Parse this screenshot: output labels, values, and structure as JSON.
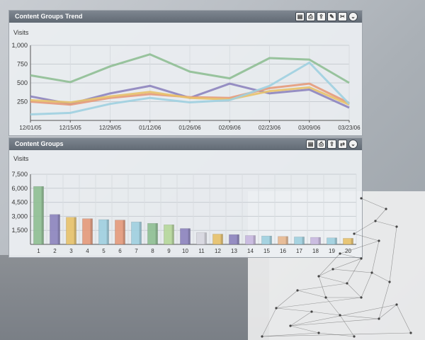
{
  "top_panel": {
    "title": "Content Groups Trend",
    "tools": [
      "doc-icon",
      "print-icon",
      "export-icon",
      "settings-icon",
      "edit-icon"
    ]
  },
  "bottom_panel": {
    "title": "Content Groups",
    "tools": [
      "doc-icon",
      "print-icon",
      "export-icon",
      "link-icon"
    ]
  },
  "chart_data": [
    {
      "type": "line",
      "title": "Content Groups Trend",
      "ylabel": "Visits",
      "x": [
        "12/01/05",
        "12/15/05",
        "12/29/05",
        "01/12/06",
        "01/26/06",
        "02/09/06",
        "02/23/06",
        "03/09/06",
        "03/23/06"
      ],
      "ylim": [
        0,
        1000
      ],
      "yticks": [
        "1,000",
        "750",
        "500",
        "250"
      ],
      "series": [
        {
          "values": [
            600,
            510,
            720,
            880,
            650,
            560,
            830,
            810,
            500
          ],
          "color": "#8fbf93"
        },
        {
          "values": [
            320,
            220,
            360,
            460,
            300,
            490,
            360,
            410,
            170
          ],
          "color": "#8d84be"
        },
        {
          "values": [
            250,
            210,
            300,
            350,
            310,
            300,
            430,
            490,
            230
          ],
          "color": "#e59a7a"
        },
        {
          "values": [
            270,
            240,
            320,
            380,
            300,
            280,
            390,
            440,
            210
          ],
          "color": "#e8c26a"
        },
        {
          "values": [
            80,
            100,
            220,
            300,
            240,
            270,
            460,
            770,
            220
          ],
          "color": "#9fd0e0"
        }
      ]
    },
    {
      "type": "bar",
      "title": "Content Groups",
      "ylabel": "Visits",
      "categories": [
        "1",
        "2",
        "3",
        "4",
        "5",
        "6",
        "7",
        "8",
        "9",
        "10",
        "11",
        "12",
        "13",
        "14",
        "15",
        "16",
        "17",
        "18",
        "19",
        "20"
      ],
      "values": [
        6200,
        3200,
        2900,
        2750,
        2650,
        2600,
        2400,
        2250,
        2100,
        1700,
        1250,
        1100,
        1050,
        950,
        900,
        850,
        800,
        750,
        700,
        650
      ],
      "ylim": [
        0,
        7500
      ],
      "yticks": [
        "7,500",
        "6,000",
        "4,500",
        "3,000",
        "1,500"
      ],
      "colors": [
        "#8fbf93",
        "#8d84be",
        "#e8c26a",
        "#e59a7a",
        "#9fd0e0",
        "#e59a7a",
        "#9fd0e0",
        "#8fbf93",
        "#b6d89a",
        "#8d84be",
        "#d8d8e0",
        "#e8c26a",
        "#8d84be",
        "#c8b8e0",
        "#9fd0e0",
        "#e8b890",
        "#9fd0e0",
        "#c8b8e0",
        "#9fd0e0",
        "#e8c26a"
      ]
    }
  ]
}
